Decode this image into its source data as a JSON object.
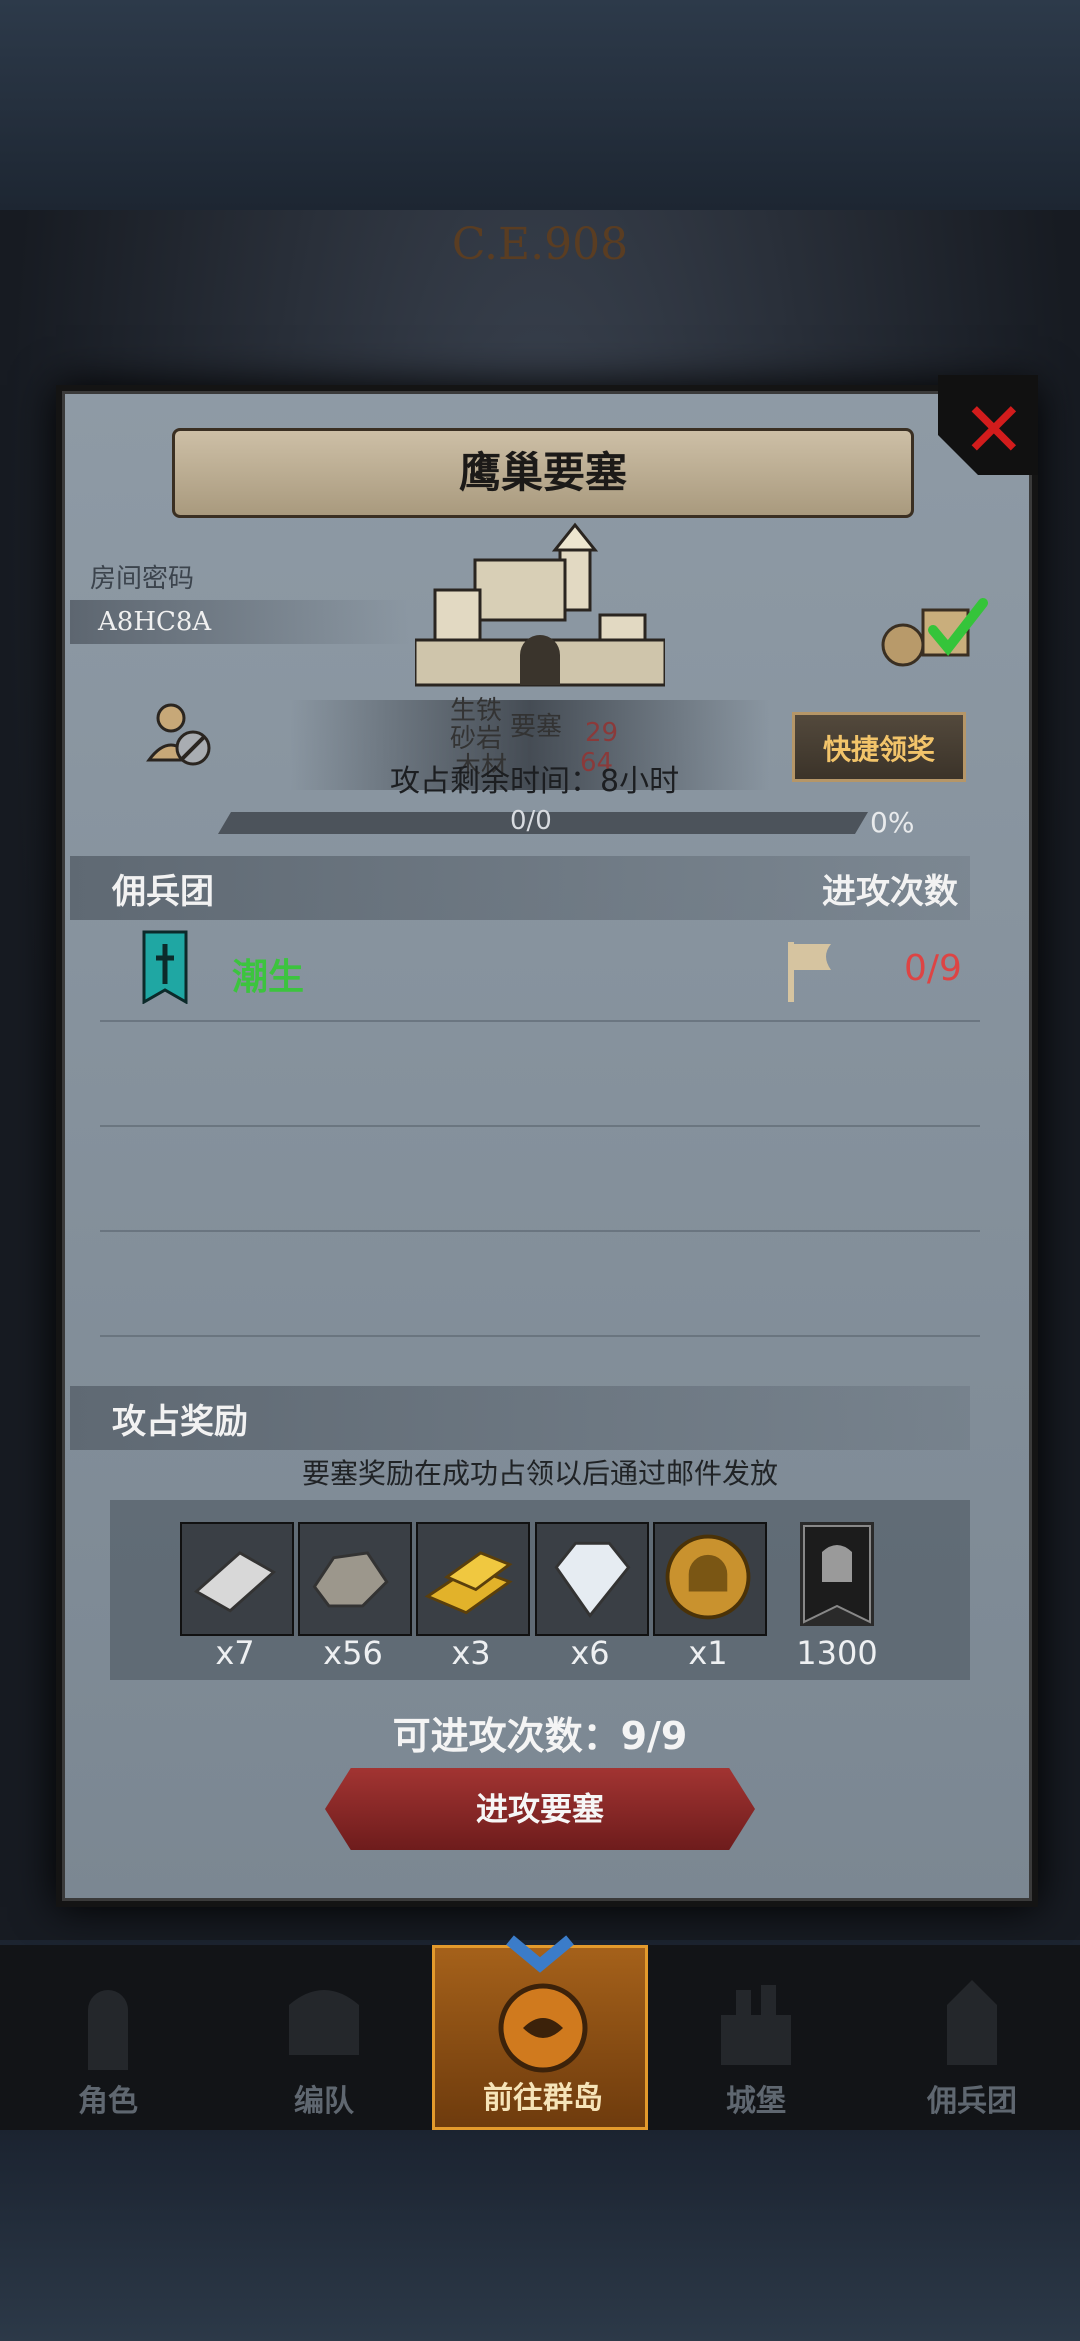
{
  "era": "C.E.908",
  "dialog": {
    "title": "鹰巢要塞",
    "room_label": "房间密码",
    "room_code": "A8HC8A",
    "ghost_labels": [
      "生铁",
      "砂岩",
      "要塞",
      "木材",
      "29",
      "64"
    ],
    "timer": "攻占剩余时间：8小时",
    "quick_claim_label": "快捷领奖",
    "progress_text": "0/0",
    "progress_percent": "0%",
    "progress_value": 0,
    "mercenary_section": "佣兵团",
    "attack_count_header": "进攻次数",
    "guilds": [
      {
        "name": "潮生",
        "attacks": "0/9"
      }
    ],
    "reward_section": "攻占奖励",
    "reward_note": "要塞奖励在成功占领以后通过邮件发放",
    "rewards": [
      {
        "icon": "iron-bar-icon",
        "qty": "x7"
      },
      {
        "icon": "stone-icon",
        "qty": "x56"
      },
      {
        "icon": "gold-bar-icon",
        "qty": "x3"
      },
      {
        "icon": "diamond-icon",
        "qty": "x6"
      },
      {
        "icon": "helmet-coin-icon",
        "qty": "x1"
      },
      {
        "icon": "banner-bull-icon",
        "qty": "1300"
      }
    ],
    "can_attack": "可进攻次数：9/9",
    "attack_button": "进攻要塞"
  },
  "nav": [
    {
      "label": "角色",
      "icon": "knight-icon"
    },
    {
      "label": "编队",
      "icon": "armor-icon"
    },
    {
      "label": "前往群岛",
      "icon": "island-icon",
      "active": true
    },
    {
      "label": "城堡",
      "icon": "castle-icon"
    },
    {
      "label": "佣兵团",
      "icon": "fortress-icon"
    }
  ],
  "colors": {
    "accent_green": "#3cc43e",
    "accent_red": "#d44",
    "button_gold": "#f2c46a"
  }
}
